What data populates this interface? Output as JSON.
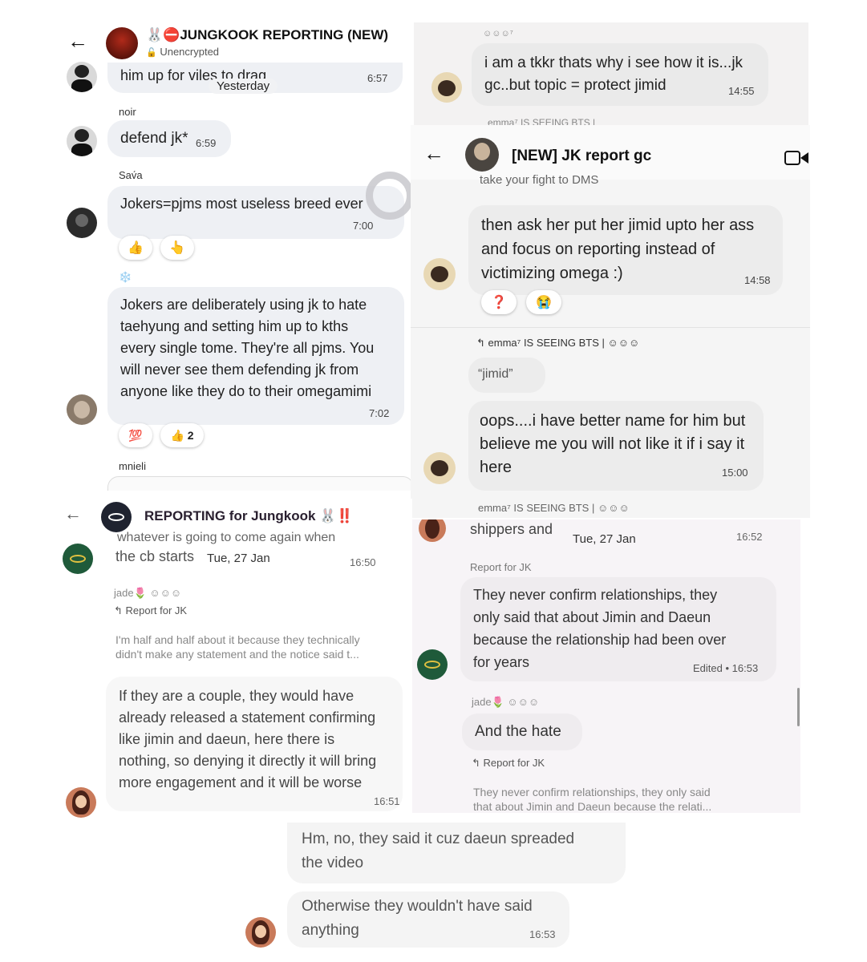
{
  "panel1": {
    "header": {
      "back": "←",
      "title_emoji": "🐰⛔",
      "title": "JUNGKOOK REPORTING (NEW)",
      "subtitle": "Unencrypted",
      "lock": "🔓"
    },
    "messages": [
      {
        "text": "him up for viles to drag",
        "time": "6:57"
      },
      {
        "sender": "noir",
        "text": "defend jk*",
        "time": "6:59"
      },
      {
        "sender": "Sav́a",
        "text": "Jokers=pjms most useless breed ever",
        "time": "7:00",
        "reactions": [
          "👍",
          "👆"
        ]
      },
      {
        "sender_icon": "❄️",
        "lines": [
          "Jokers are deliberately using jk to hate",
          "taehyung and setting him up to kths",
          "every single tome. They're all pjms. You",
          "will never see them defending jk from",
          "anyone like they do to their omegamimi"
        ],
        "time": "7:02",
        "reactions": [
          "💯",
          "👍 2"
        ]
      }
    ],
    "day_badge": "Yesterday",
    "next_sender": "mnieli"
  },
  "panel2": {
    "sender": "☺☺☺⁷",
    "lines": [
      "i am a tkkr thats why i see how it is...jk",
      "gc..but topic = protect jimid"
    ],
    "time": "14:55",
    "cut_text": "emma⁷ IS SEEING BTS |"
  },
  "panel3": {
    "header": {
      "back": "←",
      "title": "[NEW] JK report gc"
    },
    "cut_top": "take your fight to DMS",
    "messages": [
      {
        "lines": [
          "then ask her put her jimid upto her ass",
          "and focus on reporting instead of",
          "victimizing omega :)"
        ],
        "time": "14:58",
        "reactions": [
          "❓",
          "😭"
        ]
      },
      {
        "reply_to": "emma⁷ IS SEEING BTS | ☺☺☺",
        "quote": "“jimid”",
        "lines": [
          "oops....i have better name for him but",
          "believe me you will not like it if i say it",
          "here"
        ],
        "time": "15:00"
      }
    ],
    "footer_sender": "emma⁷ IS SEEING BTS | ☺☺☺"
  },
  "panel4": {
    "header": {
      "back": "←",
      "title": "REPORTING for Jungkook 🐰‼️"
    },
    "cut_top": "whatever is going to come again when",
    "first_line": "the cb starts",
    "day": "Tue, 27 Jan",
    "time1": "16:50",
    "sender": "jade🌷 ☺☺☺",
    "reply_label": "Report for JK",
    "quote_lines": [
      "I'm half and half about it because they technically",
      "didn't make any statement and the notice said t..."
    ],
    "lines": [
      "If they are a couple, they would have",
      "already released a statement confirming",
      "like jimin and daeun, here there is",
      "nothing, so denying it directly it will bring",
      "more engagement and it will be worse"
    ],
    "time2": "16:51"
  },
  "panel5": {
    "top_text": "shippers and",
    "day": "Tue, 27 Jan",
    "time1": "16:52",
    "reply_label": "Report for JK",
    "lines": [
      "They never confirm relationships, they",
      "only said that about Jimin and Daeun",
      "because the relationship had been over",
      "for years"
    ],
    "edited": "Edited • 16:53",
    "sender": "jade🌷 ☺☺☺",
    "msg2": "And the hate",
    "reply_label2": "Report for JK",
    "quote_lines": [
      "They never confirm relationships, they only said",
      "that about Jimin and Daeun because the relati..."
    ]
  },
  "panel6": {
    "lines1": [
      "Hm, no, they said it cuz daeun spreaded",
      "the video"
    ],
    "lines2": [
      "Otherwise they wouldn't have said",
      "anything"
    ],
    "time": "16:53"
  }
}
